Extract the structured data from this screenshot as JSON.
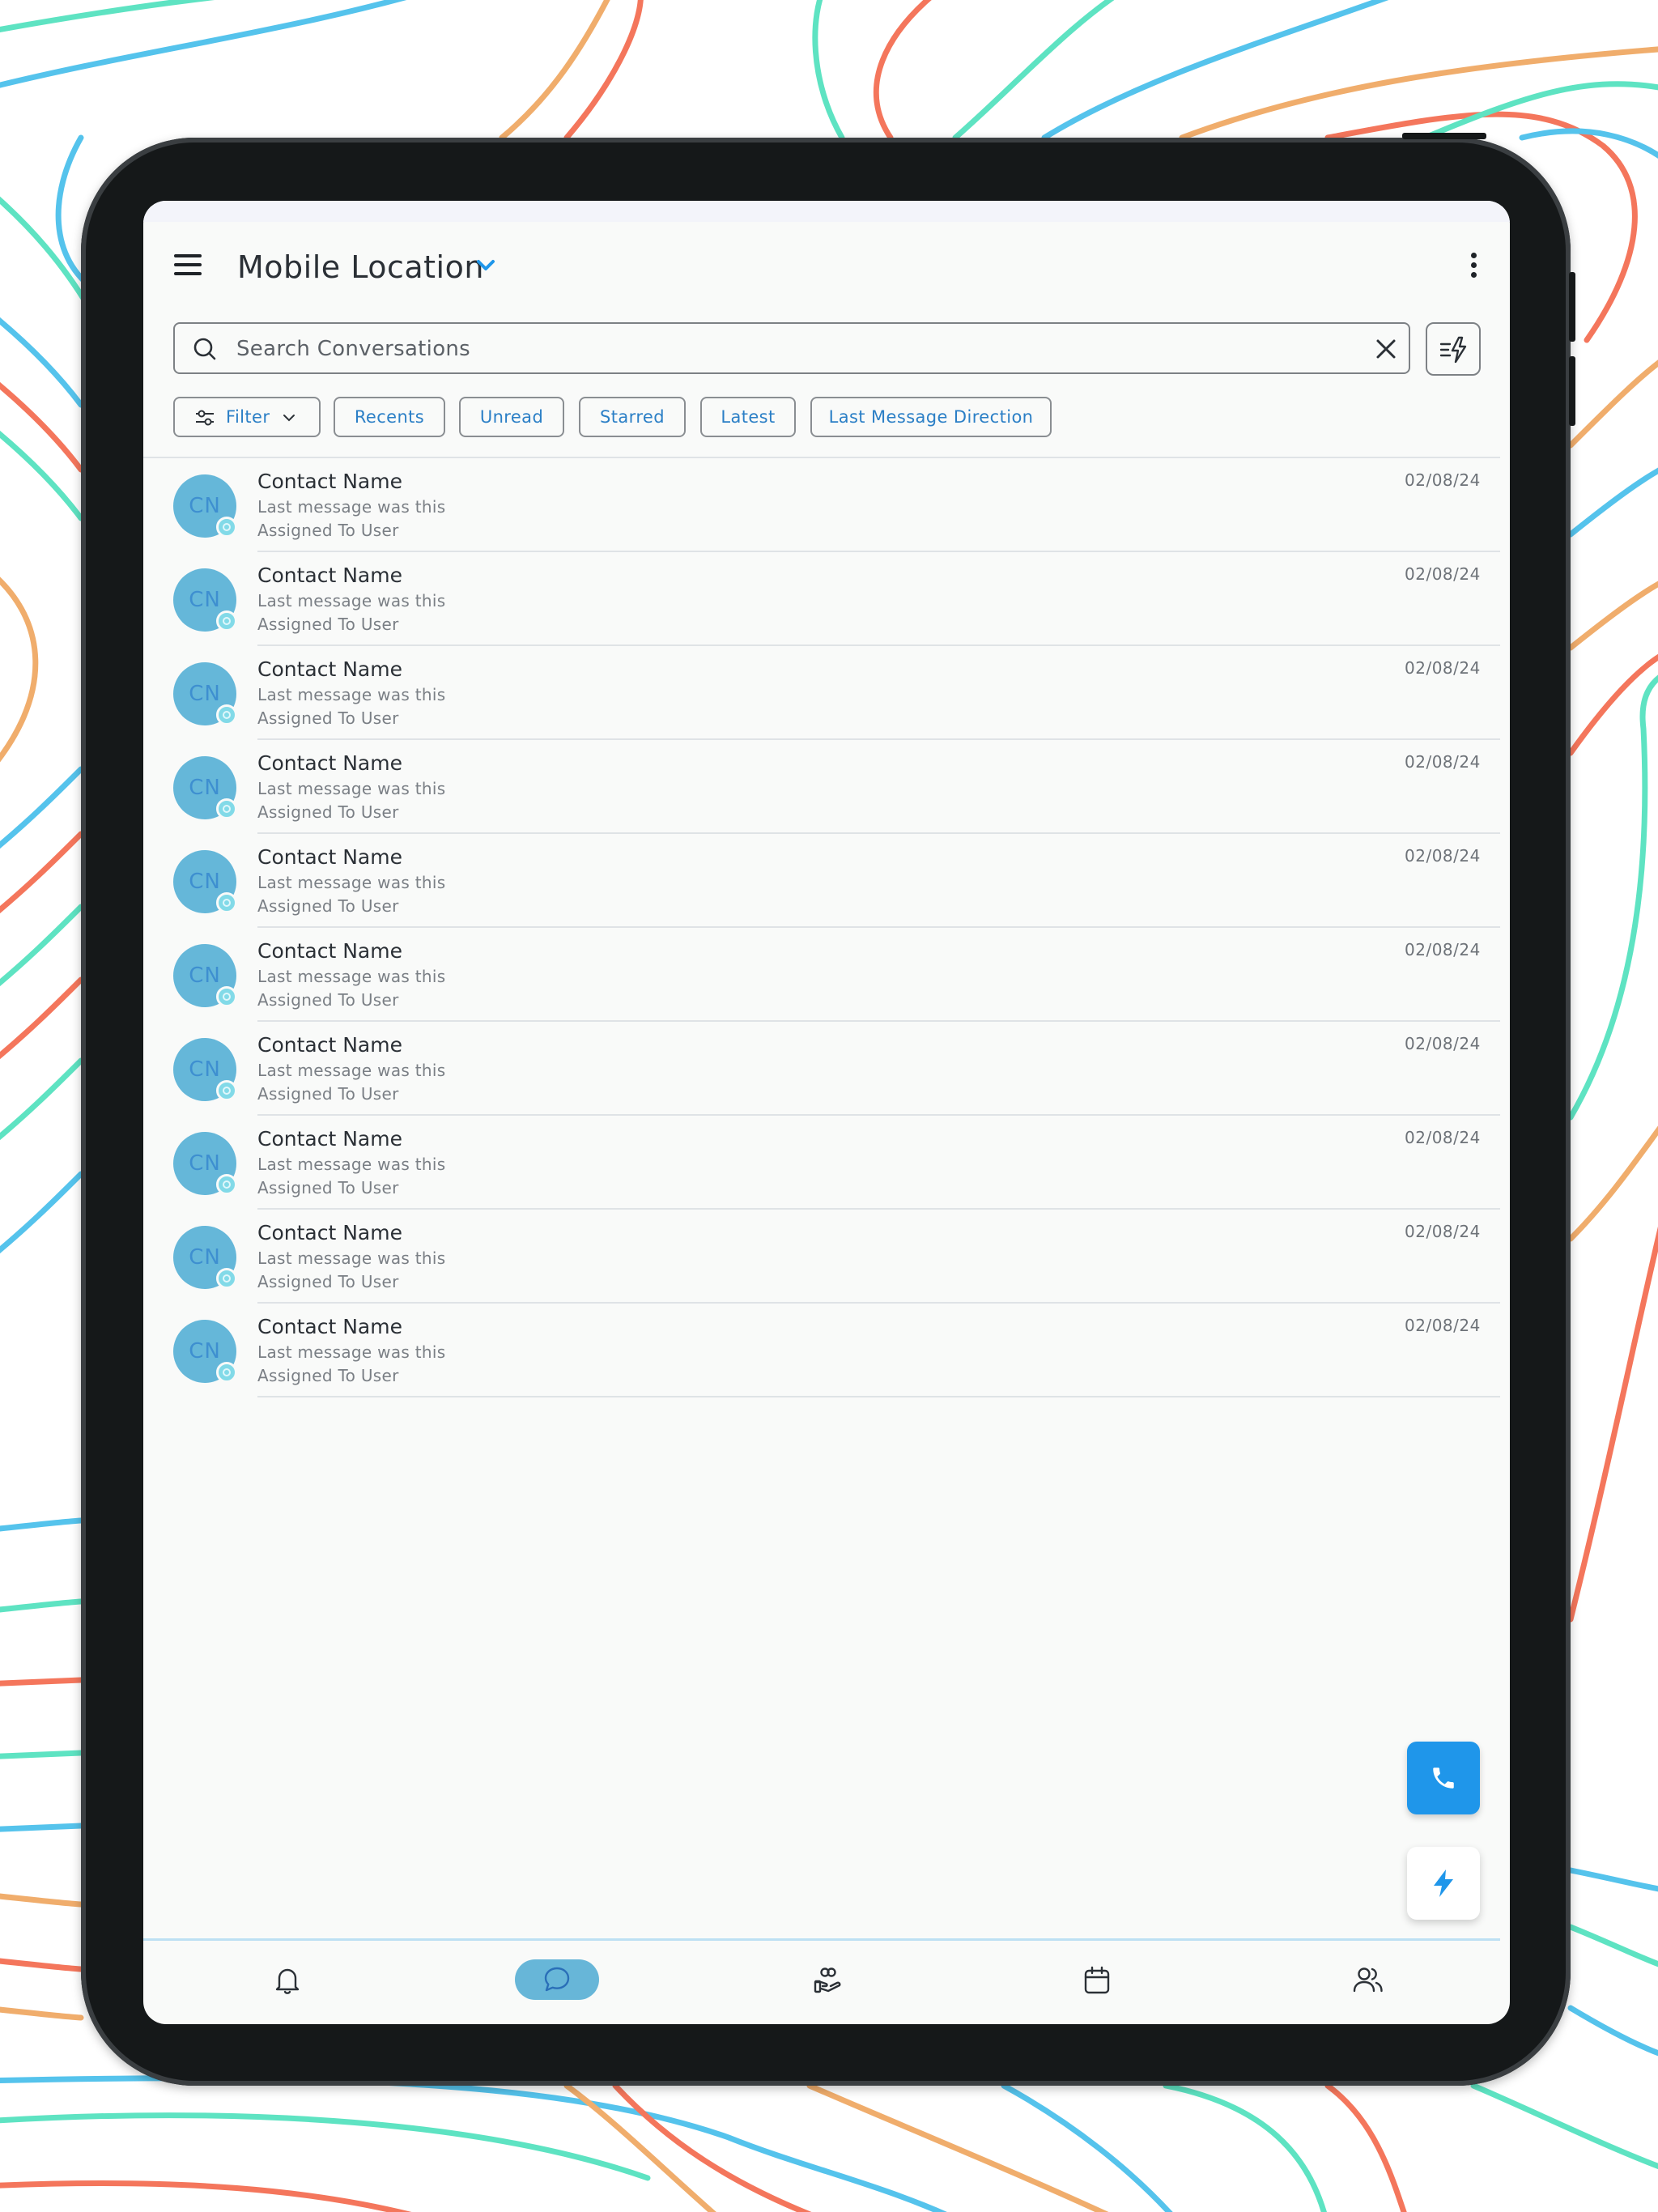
{
  "app": {
    "location_title": "Mobile Location"
  },
  "search": {
    "placeholder": "Search Conversations"
  },
  "chips": [
    {
      "label": "Filter",
      "icon": "filter-sliders-icon"
    },
    {
      "label": "Recents"
    },
    {
      "label": "Unread"
    },
    {
      "label": "Starred"
    },
    {
      "label": "Latest"
    },
    {
      "label": "Last Message Direction"
    }
  ],
  "conversations": [
    {
      "initials": "CN",
      "name": "Contact Name",
      "last_message": "Last message was this",
      "assigned": "Assigned To User",
      "date": "02/08/24"
    },
    {
      "initials": "CN",
      "name": "Contact Name",
      "last_message": "Last message was this",
      "assigned": "Assigned To User",
      "date": "02/08/24"
    },
    {
      "initials": "CN",
      "name": "Contact Name",
      "last_message": "Last message was this",
      "assigned": "Assigned To User",
      "date": "02/08/24"
    },
    {
      "initials": "CN",
      "name": "Contact Name",
      "last_message": "Last message was this",
      "assigned": "Assigned To User",
      "date": "02/08/24"
    },
    {
      "initials": "CN",
      "name": "Contact Name",
      "last_message": "Last message was this",
      "assigned": "Assigned To User",
      "date": "02/08/24"
    },
    {
      "initials": "CN",
      "name": "Contact Name",
      "last_message": "Last message was this",
      "assigned": "Assigned To User",
      "date": "02/08/24"
    },
    {
      "initials": "CN",
      "name": "Contact Name",
      "last_message": "Last message was this",
      "assigned": "Assigned To User",
      "date": "02/08/24"
    },
    {
      "initials": "CN",
      "name": "Contact Name",
      "last_message": "Last message was this",
      "assigned": "Assigned To User",
      "date": "02/08/24"
    },
    {
      "initials": "CN",
      "name": "Contact Name",
      "last_message": "Last message was this",
      "assigned": "Assigned To User",
      "date": "02/08/24"
    },
    {
      "initials": "CN",
      "name": "Contact Name",
      "last_message": "Last message was this",
      "assigned": "Assigned To User",
      "date": "02/08/24"
    }
  ],
  "fabs": {
    "call_icon": "phone-icon",
    "quick_icon": "lightning-icon"
  },
  "bottom_nav": [
    {
      "icon": "bell-icon",
      "active": false
    },
    {
      "icon": "chat-bubble-icon",
      "active": true
    },
    {
      "icon": "hand-heart-icon",
      "active": false
    },
    {
      "icon": "calendar-icon",
      "active": false
    },
    {
      "icon": "contacts-icon",
      "active": false
    }
  ],
  "colors": {
    "accent": "#1f96ea",
    "chip_text": "#2b7fc6",
    "avatar": "#65b7d9",
    "nav_active": "#67b6d8",
    "frame": "#151819",
    "screen_bg": "#f9faf9"
  }
}
